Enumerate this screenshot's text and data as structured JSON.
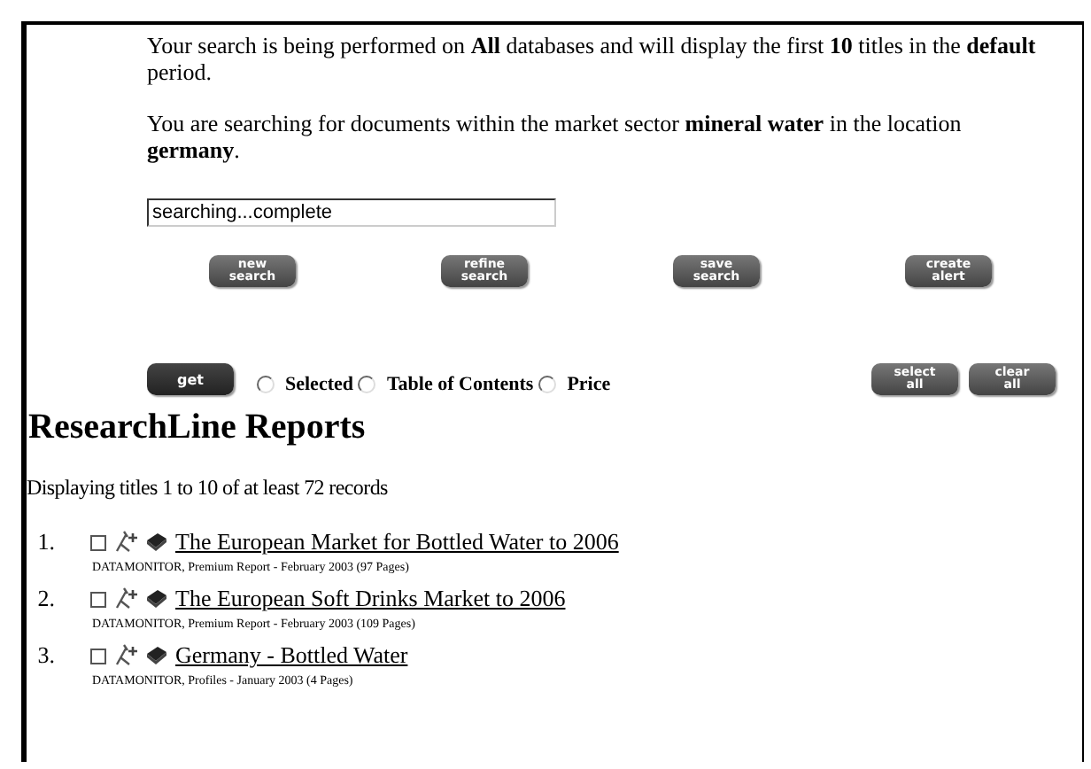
{
  "intro": {
    "search_scope": "Your search is being performed on **All** databases and will display the first **10** titles in the **default** period.",
    "search_sector": "You are searching for documents within the market sector **mineral water** in the location **germany**."
  },
  "status_field": {
    "value": "searching...complete"
  },
  "actions": [
    {
      "label": "new\nsearch"
    },
    {
      "label": "refine\nsearch"
    },
    {
      "label": "save\nsearch"
    },
    {
      "label": "create\nalert"
    }
  ],
  "get_button": {
    "label": "get"
  },
  "get_options": [
    {
      "label": "Selected",
      "selected": false
    },
    {
      "label": "Table of Contents",
      "selected": false
    },
    {
      "label": "Price",
      "selected": false
    }
  ],
  "selection_buttons": [
    {
      "label": "select\nall"
    },
    {
      "label": "clear\nall"
    }
  ],
  "heading": "ResearchLine Reports",
  "summary": "Displaying titles 1 to 10 of at least 72 records",
  "results": [
    {
      "number": "1.",
      "checked": false,
      "title": "The European Market for Bottled Water to 2006",
      "details": "DATAMONITOR, Premium Report - February 2003 (97 Pages)"
    },
    {
      "number": "2.",
      "checked": false,
      "title": "The European Soft Drinks Market to 2006",
      "details": "DATAMONITOR, Premium Report - February 2003 (109 Pages)"
    },
    {
      "number": "3.",
      "checked": false,
      "title": "Germany - Bottled Water",
      "details": "DATAMONITOR, Profiles - January 2003 (4 Pages)"
    }
  ]
}
